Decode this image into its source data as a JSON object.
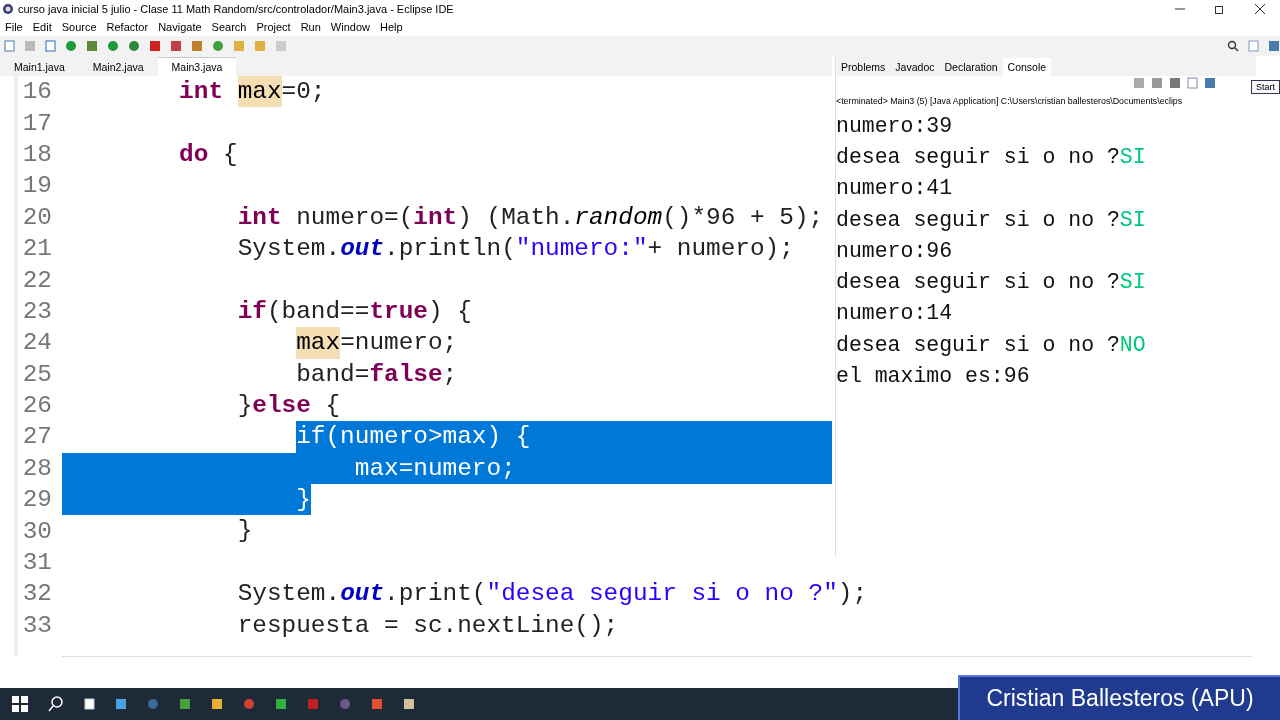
{
  "window": {
    "title": "curso java inicial 5 julio - Clase 11 Math Random/src/controlador/Main3.java - Eclipse IDE"
  },
  "menu": [
    "File",
    "Edit",
    "Source",
    "Refactor",
    "Navigate",
    "Search",
    "Project",
    "Run",
    "Window",
    "Help"
  ],
  "editor_tabs": [
    {
      "label": "Main1.java",
      "selected": false
    },
    {
      "label": "Main2.java",
      "selected": false
    },
    {
      "label": "Main3.java",
      "selected": true
    }
  ],
  "code_lines": [
    {
      "number": "16",
      "segments": [
        {
          "text": "        int ",
          "kind": "keyword",
          "selected": false
        },
        {
          "text": "max",
          "kind": "occurrence",
          "selected": false
        },
        {
          "text": "=0;",
          "kind": "plain",
          "selected": false
        }
      ]
    },
    {
      "number": "17"
    },
    {
      "number": "18",
      "segments": [
        {
          "text": "        do",
          "kind": "keyword",
          "selected": false
        },
        {
          "text": " {",
          "kind": "plain",
          "selected": false
        }
      ]
    },
    {
      "number": "19"
    },
    {
      "number": "20",
      "segments": [
        {
          "text": "            int",
          "kind": "keyword",
          "selected": false
        },
        {
          "text": " numero=(",
          "kind": "plain",
          "selected": false
        },
        {
          "text": "int",
          "kind": "keyword",
          "selected": false
        },
        {
          "text": ") (Math.",
          "kind": "plain",
          "selected": false
        },
        {
          "text": "random",
          "kind": "static",
          "selected": false
        },
        {
          "text": "()*96 + 5);",
          "kind": "plain",
          "selected": false
        }
      ]
    },
    {
      "number": "21",
      "segments": [
        {
          "text": "            System.",
          "kind": "plain",
          "selected": false
        },
        {
          "text": "out",
          "kind": "field",
          "selected": false
        },
        {
          "text": ".println(",
          "kind": "plain",
          "selected": false
        },
        {
          "text": "\"numero:\"",
          "kind": "string",
          "selected": false
        },
        {
          "text": "+ numero);",
          "kind": "plain",
          "selected": false
        }
      ]
    },
    {
      "number": "22"
    },
    {
      "number": "23",
      "segments": [
        {
          "text": "            if",
          "kind": "keyword",
          "selected": false
        },
        {
          "text": "(band==",
          "kind": "plain",
          "selected": false
        },
        {
          "text": "true",
          "kind": "keyword",
          "selected": false
        },
        {
          "text": ") {",
          "kind": "plain",
          "selected": false
        }
      ]
    },
    {
      "number": "24",
      "segments": [
        {
          "text": "                max",
          "kind": "occurrence",
          "selected": false
        },
        {
          "text": "=numero;",
          "kind": "plain",
          "selected": false
        }
      ]
    },
    {
      "number": "25",
      "segments": [
        {
          "text": "                band=",
          "kind": "plain",
          "selected": false
        },
        {
          "text": "false",
          "kind": "keyword",
          "selected": false
        },
        {
          "text": ";",
          "kind": "plain",
          "selected": false
        }
      ]
    },
    {
      "number": "26",
      "segments": [
        {
          "text": "            }",
          "kind": "plain",
          "selected": false
        },
        {
          "text": "else",
          "kind": "keyword",
          "selected": false
        },
        {
          "text": " {",
          "kind": "plain",
          "selected": false
        }
      ]
    },
    {
      "number": "27",
      "selected_from_start": false,
      "selected_to_end": true,
      "segments": [
        {
          "text": "                if(numero>max) {",
          "kind": "plain",
          "selected": true
        }
      ]
    },
    {
      "number": "28",
      "selected_from_start": true,
      "selected_to_end": true,
      "segments": [
        {
          "text": "                    max=numero;",
          "kind": "plain",
          "selected": true
        }
      ]
    },
    {
      "number": "29",
      "selected_from_start": true,
      "segments": [
        {
          "text": "                }",
          "kind": "plain",
          "selected": true
        }
      ]
    },
    {
      "number": "30",
      "segments": [
        {
          "text": "            }",
          "kind": "plain",
          "selected": false
        }
      ]
    },
    {
      "number": "31"
    },
    {
      "number": "32",
      "segments": [
        {
          "text": "            System.",
          "kind": "plain",
          "selected": false
        },
        {
          "text": "out",
          "kind": "field",
          "selected": false
        },
        {
          "text": ".print(",
          "kind": "plain",
          "selected": false
        },
        {
          "text": "\"desea seguir si o no ?\"",
          "kind": "string",
          "selected": false
        },
        {
          "text": ");",
          "kind": "plain",
          "selected": false
        }
      ]
    },
    {
      "number": "33",
      "segments": [
        {
          "text": "            respuesta = sc.nextLine();",
          "kind": "plain",
          "selected": false
        }
      ]
    }
  ],
  "console": {
    "tabs": [
      {
        "label": "Problems",
        "selected": false
      },
      {
        "label": "Javadoc",
        "selected": false
      },
      {
        "label": "Declaration",
        "selected": false
      },
      {
        "label": "Console",
        "selected": true
      }
    ],
    "tooltip": "Start",
    "status": "<terminated> Main3 (5) [Java Application] C:\\Users\\cristian ballesteros\\Documents\\eclips",
    "lines": [
      [
        {
          "text": "numero:39",
          "kind": "output"
        }
      ],
      [
        {
          "text": "desea seguir si o no ?",
          "kind": "output"
        },
        {
          "text": "SI",
          "kind": "input"
        }
      ],
      [
        {
          "text": "numero:41",
          "kind": "output"
        }
      ],
      [
        {
          "text": "desea seguir si o no ?",
          "kind": "output"
        },
        {
          "text": "SI",
          "kind": "input"
        }
      ],
      [
        {
          "text": "numero:96",
          "kind": "output"
        }
      ],
      [
        {
          "text": "desea seguir si o no ?",
          "kind": "output"
        },
        {
          "text": "SI",
          "kind": "input"
        }
      ],
      [
        {
          "text": "numero:14",
          "kind": "output"
        }
      ],
      [
        {
          "text": "desea seguir si o no ?",
          "kind": "output"
        },
        {
          "text": "NO",
          "kind": "input"
        }
      ],
      [
        {
          "text": "el maximo es:96",
          "kind": "output"
        }
      ]
    ]
  },
  "presenter_label": "Cristian Ballesteros (APU)"
}
